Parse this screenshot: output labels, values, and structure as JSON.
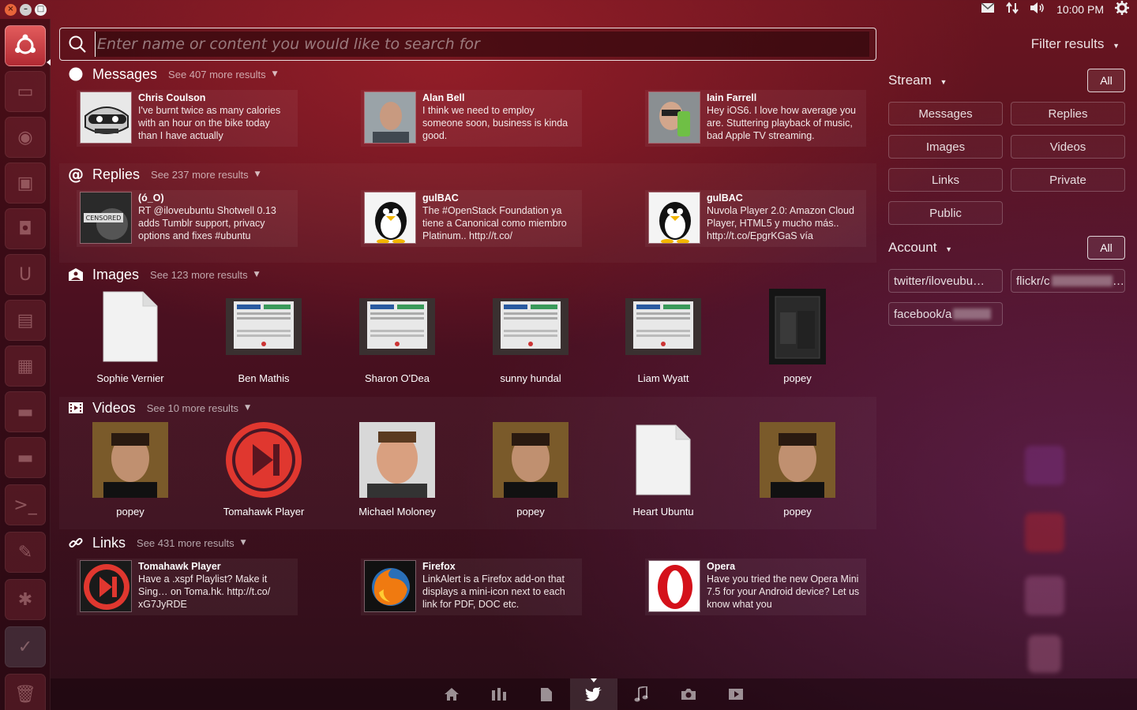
{
  "top_panel": {
    "window_controls": [
      "×",
      "–",
      "□"
    ],
    "clock": "10:00 PM",
    "indicators": [
      "mail-icon",
      "network-icon",
      "volume-icon",
      "session-gear-icon"
    ]
  },
  "launcher": {
    "items": [
      "ubuntu-dash-icon",
      "files-icon",
      "firefox-icon",
      "software-center-icon",
      "shotwell-icon",
      "ubuntu-one-icon",
      "image-viewer-icon",
      "system-monitor-icon",
      "drive-icon",
      "drive-icon",
      "terminal-icon",
      "text-editor-icon",
      "app-icon",
      "gwibber-icon",
      "trash-icon"
    ]
  },
  "search": {
    "placeholder": "Enter name or content you would like to search for"
  },
  "filter": {
    "title": "Filter results",
    "stream_label": "Stream",
    "stream_all": "All",
    "stream_buttons": [
      "Messages",
      "Replies",
      "Images",
      "Videos",
      "Links",
      "Private",
      "Public"
    ],
    "account_label": "Account",
    "account_all": "All",
    "accounts": [
      "twitter/iloveubu…",
      "flickr/c",
      "facebook/a"
    ]
  },
  "categories": {
    "messages": {
      "title": "Messages",
      "more": "See 407 more results",
      "items": [
        {
          "name": "Chris Coulson",
          "text": "I've burnt twice as many calories with an hour on the bike today than I have actually"
        },
        {
          "name": "Alan Bell",
          "text": "I think we need to employ someone soon, business is kinda good."
        },
        {
          "name": "Iain Farrell",
          "text": "Hey iOS6. I love how average you are. Stuttering playback of music, bad Apple TV streaming."
        }
      ]
    },
    "replies": {
      "title": "Replies",
      "more": "See 237 more results",
      "items": [
        {
          "name": "(ó_O)",
          "text": "RT @iloveubuntu Shotwell 0.13 adds Tumblr support, privacy options and fixes #ubuntu"
        },
        {
          "name": "gulBAC",
          "text": "The #OpenStack Foundation ya tiene a Canonical como miembro Platinum.. http://t.co/"
        },
        {
          "name": "gulBAC",
          "text": "Nuvola Player 2.0: Amazon Cloud Player, HTML5 y mucho más.. http://t.co/EpgrKGaS vía"
        }
      ]
    },
    "images": {
      "title": "Images",
      "more": "See 123 more results",
      "items": [
        "Sophie Vernier",
        "Ben Mathis",
        "Sharon O'Dea",
        "sunny hundal",
        "Liam Wyatt",
        "popey"
      ]
    },
    "videos": {
      "title": "Videos",
      "more": "See 10 more results",
      "items": [
        "popey",
        "Tomahawk Player",
        "Michael Moloney",
        "popey",
        "Heart Ubuntu",
        "popey"
      ]
    },
    "links": {
      "title": "Links",
      "more": "See 431 more results",
      "items": [
        {
          "name": "Tomahawk Player",
          "text": "Have a .xspf Playlist? Make it Sing… on Toma.hk. http://t.co/ xG7JyRDE"
        },
        {
          "name": "Firefox",
          "text": "LinkAlert is a Firefox add-on that displays a mini-icon next to each link for PDF, DOC etc."
        },
        {
          "name": "Opera",
          "text": "Have you tried the new Opera Mini 7.5 for your Android device? Let us know what you"
        }
      ]
    }
  },
  "lenses": [
    "home-lens-icon",
    "applications-lens-icon",
    "files-lens-icon",
    "social-lens-icon",
    "music-lens-icon",
    "photos-lens-icon",
    "video-lens-icon"
  ],
  "colors": {
    "accent": "#c0392b",
    "panel": "#2e0f1a"
  }
}
